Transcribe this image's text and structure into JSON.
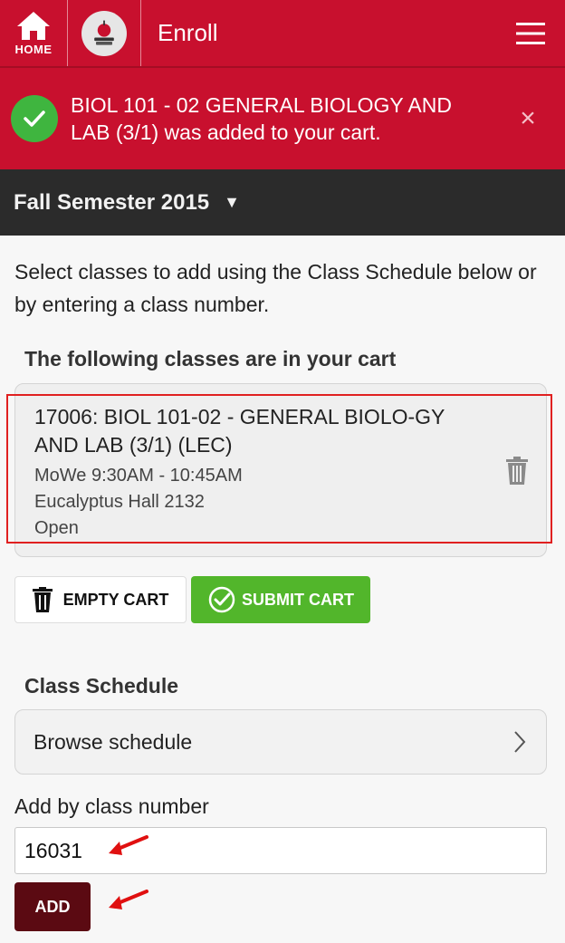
{
  "header": {
    "home_label": "HOME",
    "app_title": "Enroll"
  },
  "notification": {
    "message": "BIOL 101 - 02 GENERAL BIOLOGY AND LAB (3/1) was added to your cart.",
    "close_glyph": "×"
  },
  "semester": {
    "label": "Fall Semester 2015",
    "caret": "▼"
  },
  "intro_text": "Select classes to add using the Class Schedule below or by entering a class number.",
  "cart": {
    "heading": "The following classes are in your cart",
    "items": [
      {
        "title": "17006: BIOL 101-02 - GENERAL BIOLO-GY AND LAB (3/1) (LEC)",
        "schedule": "MoWe 9:30AM - 10:45AM",
        "location": "Eucalyptus Hall 2132",
        "status": "Open"
      }
    ],
    "empty_label": "EMPTY CART",
    "submit_label": "SUBMIT CART"
  },
  "schedule": {
    "heading": "Class Schedule",
    "browse_label": "Browse schedule"
  },
  "add_by_number": {
    "label": "Add by class number",
    "value": "16031",
    "button_label": "ADD"
  },
  "colors": {
    "brand_red": "#c8102e",
    "success_green": "#52b62b",
    "add_button": "#5b0a12",
    "semester_bar": "#2b2b2b"
  }
}
